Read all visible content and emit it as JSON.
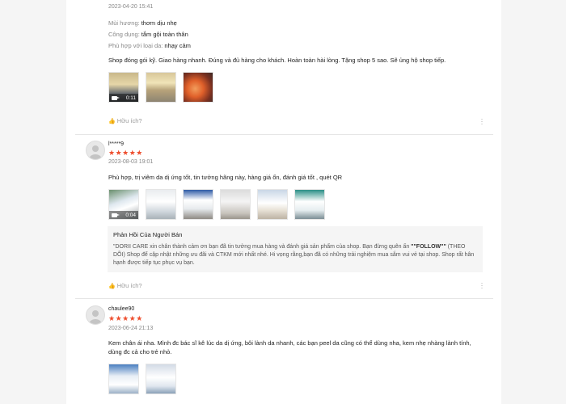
{
  "reviews": [
    {
      "user": "",
      "date": "2023-04-20 15:41",
      "attrs": [
        {
          "label": "Mùi hương:",
          "value": "thơm dịu nhẹ"
        },
        {
          "label": "Công dụng:",
          "value": "tắm gội toàn thân"
        },
        {
          "label": "Phù hợp với loại da:",
          "value": "nhạy cảm"
        }
      ],
      "content": "Shop đóng gói kỹ. Giao hàng nhanh. Đúng và đủ hàng cho khách. Hoàn toàn hài lòng. Tặng shop 5 sao. Sẽ ủng hộ shop tiếp.",
      "video_duration": "0:11",
      "helpful": "Hữu ích?"
    },
    {
      "user": "l*****9",
      "stars": "★★★★★",
      "date": "2023-08-03 19:01",
      "content": "Phù hợp, trị viêm da dị ứng tốt, tin tưởng hãng này, hàng giá ổn, đánh giá tốt , quét QR",
      "video_duration": "0:04",
      "reply_title": "Phản Hồi Của Người Bán",
      "reply_body_1": "\"DORII CARE xin chân thành cảm ơn bạn đã tin tưởng mua hàng và đánh giá sản phẩm của shop. Bạn đừng quên ấn",
      "reply_follow": "\"\"FOLLOW\"\"",
      "reply_body_2": " (THEO DÕI) Shop để cập nhật những ưu đãi và CTKM mới nhất nhé. Hi vọng rằng,bạn đã có những trải nghiệm mua sắm vui vẻ tại shop. Shop rất hân hạnh được tiếp tục phục vụ bạn.",
      "helpful": "Hữu ích?"
    },
    {
      "user": "chaulee90",
      "stars": "★★★★★",
      "date": "2023-06-24 21:13",
      "content": "Kem chân ái nha. Mình đc bác sĩ kê lúc da dị ứng, bôi lành da nhanh, các bạn peel da cũng có thể dùng nha, kem nhẹ nhàng lành tính, dùng đc cả cho trẻ nhỏ."
    }
  ],
  "colors": {
    "accent": "#ee4d2d"
  }
}
